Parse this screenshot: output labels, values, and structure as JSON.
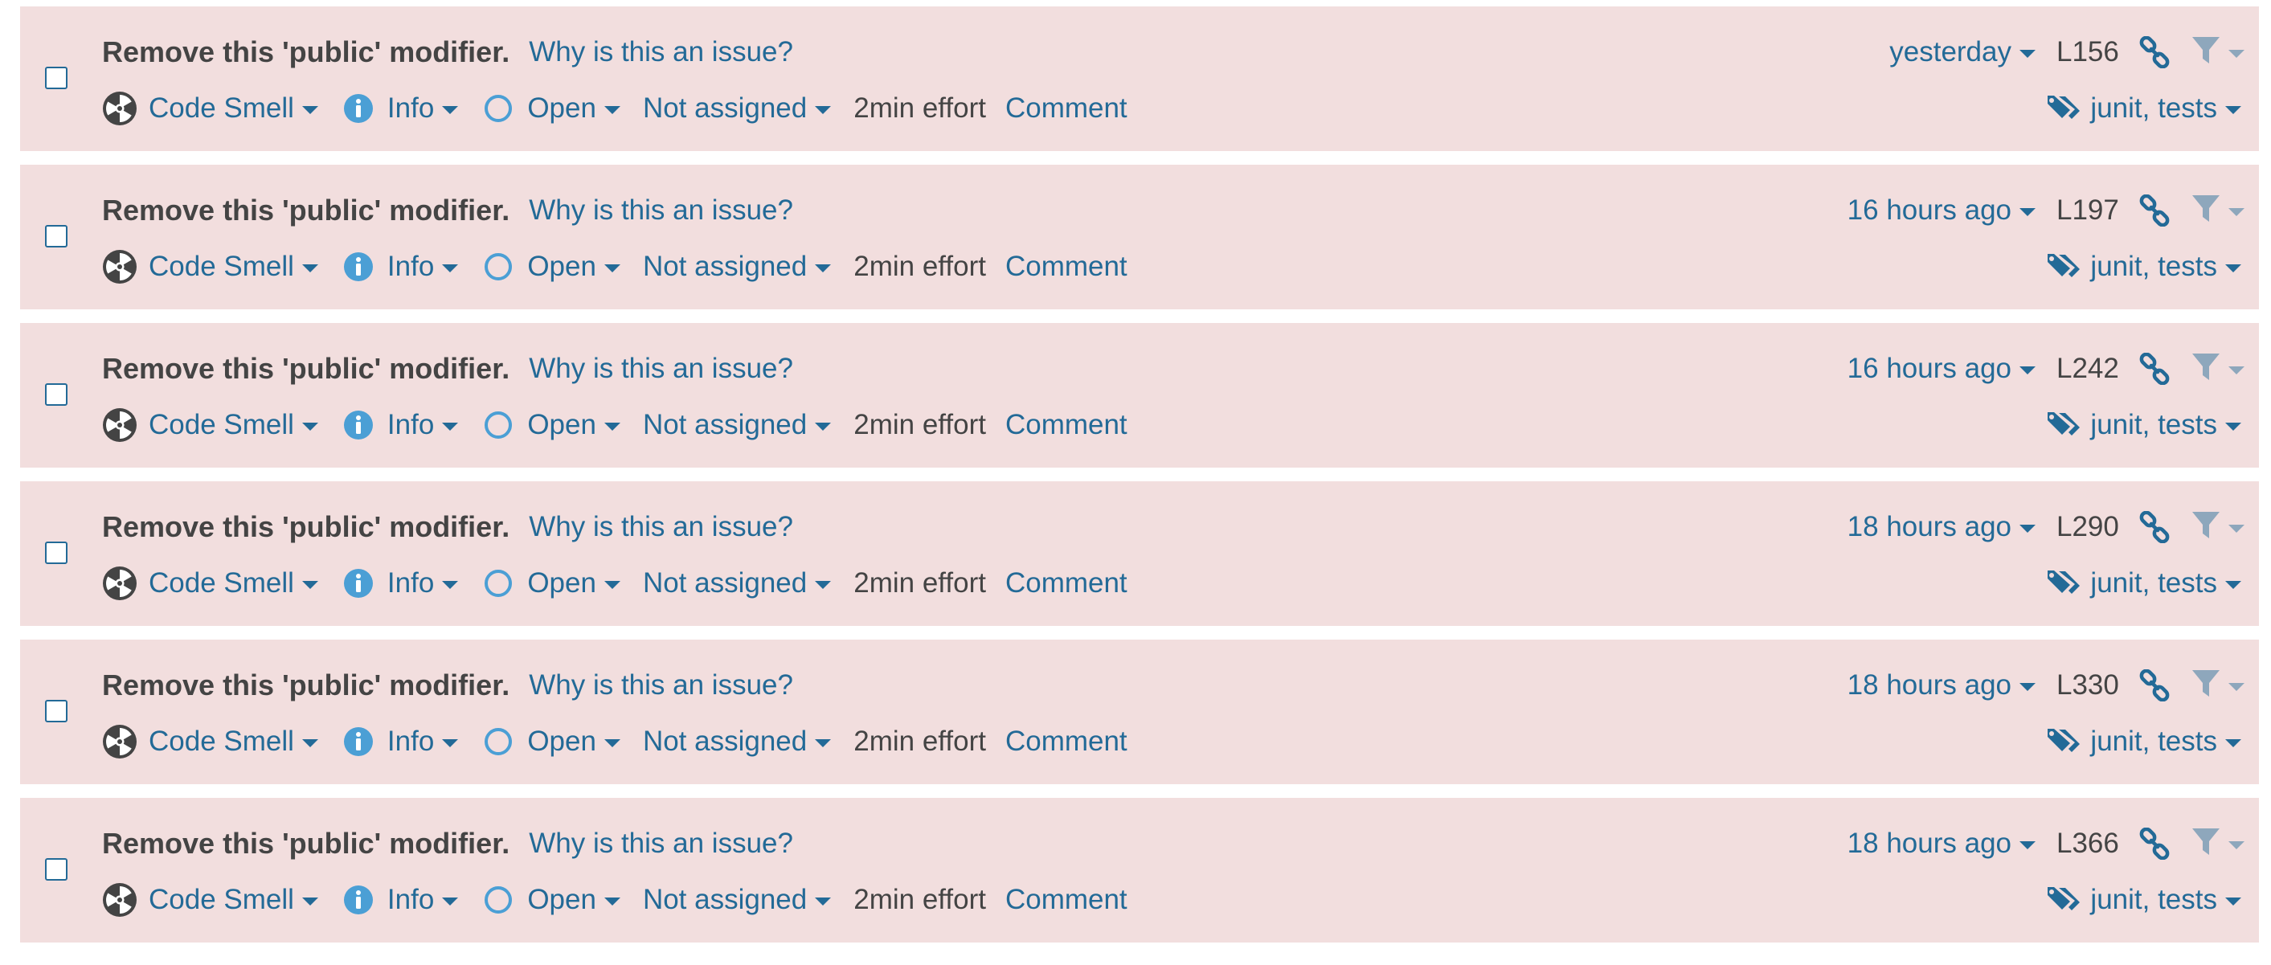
{
  "issues": [
    {
      "message": "Remove this 'public' modifier.",
      "why_link": "Why is this an issue?",
      "type": "Code Smell",
      "severity": "Info",
      "status": "Open",
      "assignee": "Not assigned",
      "effort": "2min effort",
      "comment": "Comment",
      "date": "yesterday",
      "line": "L156",
      "tags": "junit, tests"
    },
    {
      "message": "Remove this 'public' modifier.",
      "why_link": "Why is this an issue?",
      "type": "Code Smell",
      "severity": "Info",
      "status": "Open",
      "assignee": "Not assigned",
      "effort": "2min effort",
      "comment": "Comment",
      "date": "16 hours ago",
      "line": "L197",
      "tags": "junit, tests"
    },
    {
      "message": "Remove this 'public' modifier.",
      "why_link": "Why is this an issue?",
      "type": "Code Smell",
      "severity": "Info",
      "status": "Open",
      "assignee": "Not assigned",
      "effort": "2min effort",
      "comment": "Comment",
      "date": "16 hours ago",
      "line": "L242",
      "tags": "junit, tests"
    },
    {
      "message": "Remove this 'public' modifier.",
      "why_link": "Why is this an issue?",
      "type": "Code Smell",
      "severity": "Info",
      "status": "Open",
      "assignee": "Not assigned",
      "effort": "2min effort",
      "comment": "Comment",
      "date": "18 hours ago",
      "line": "L290",
      "tags": "junit, tests"
    },
    {
      "message": "Remove this 'public' modifier.",
      "why_link": "Why is this an issue?",
      "type": "Code Smell",
      "severity": "Info",
      "status": "Open",
      "assignee": "Not assigned",
      "effort": "2min effort",
      "comment": "Comment",
      "date": "18 hours ago",
      "line": "L330",
      "tags": "junit, tests"
    },
    {
      "message": "Remove this 'public' modifier.",
      "why_link": "Why is this an issue?",
      "type": "Code Smell",
      "severity": "Info",
      "status": "Open",
      "assignee": "Not assigned",
      "effort": "2min effort",
      "comment": "Comment",
      "date": "18 hours ago",
      "line": "L366",
      "tags": "junit, tests"
    }
  ],
  "icons": {
    "type": "code-smell-icon",
    "severity": "info-icon",
    "status": "open-status-icon",
    "permalink": "link-icon",
    "filter": "filter-icon",
    "tags": "tag-icon"
  },
  "colors": {
    "row_background": "#f2dede",
    "link": "#236a97",
    "text": "#444444",
    "info_blue": "#4b9fd5",
    "filter_grey": "#8ea7bc"
  }
}
